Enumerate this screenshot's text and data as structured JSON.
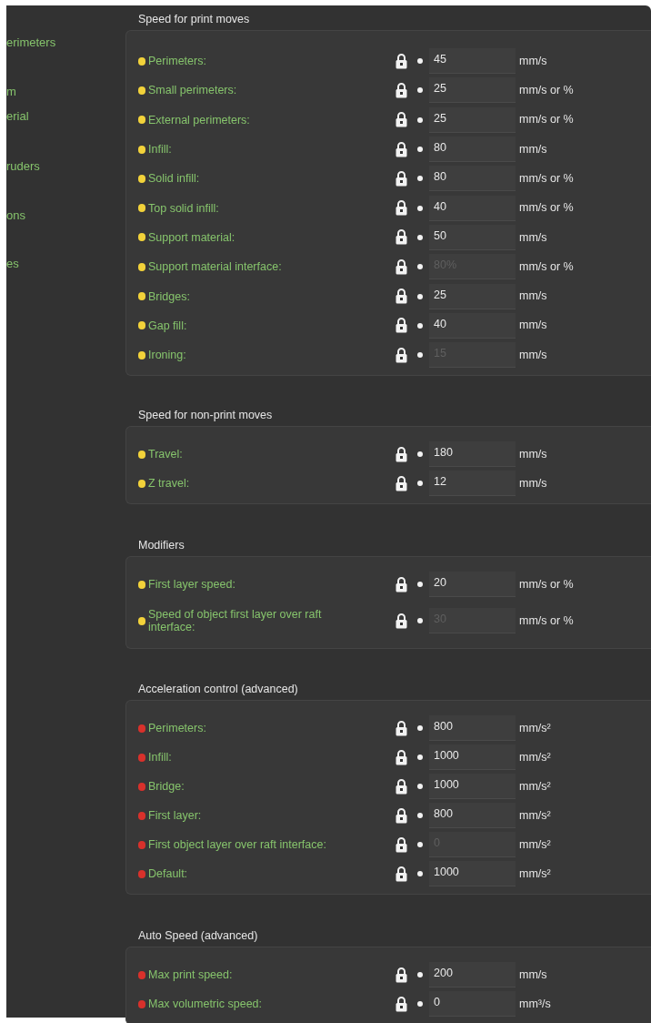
{
  "sidebar": {
    "items": [
      {
        "label": "erimeters"
      },
      {
        "label": "m"
      },
      {
        "label": "erial"
      },
      {
        "label": "ruders"
      },
      {
        "label": "ons"
      },
      {
        "label": "es"
      }
    ]
  },
  "sections": [
    {
      "title": "Speed for print moves",
      "options": [
        {
          "label": "Perimeters:",
          "color": "#f2d23a",
          "value": "45",
          "unit": "mm/s",
          "disabled": false
        },
        {
          "label": "Small perimeters:",
          "color": "#f2d23a",
          "value": "25",
          "unit": "mm/s or %",
          "disabled": false
        },
        {
          "label": "External perimeters:",
          "color": "#f2d23a",
          "value": "25",
          "unit": "mm/s or %",
          "disabled": false
        },
        {
          "label": "Infill:",
          "color": "#f2d23a",
          "value": "80",
          "unit": "mm/s",
          "disabled": false
        },
        {
          "label": "Solid infill:",
          "color": "#f2d23a",
          "value": "80",
          "unit": "mm/s or %",
          "disabled": false
        },
        {
          "label": "Top solid infill:",
          "color": "#f2d23a",
          "value": "40",
          "unit": "mm/s or %",
          "disabled": false
        },
        {
          "label": "Support material:",
          "color": "#f2d23a",
          "value": "50",
          "unit": "mm/s",
          "disabled": false
        },
        {
          "label": "Support material interface:",
          "color": "#f2d23a",
          "value": "80%",
          "unit": "mm/s or %",
          "disabled": true
        },
        {
          "label": "Bridges:",
          "color": "#f2d23a",
          "value": "25",
          "unit": "mm/s",
          "disabled": false
        },
        {
          "label": "Gap fill:",
          "color": "#f2d23a",
          "value": "40",
          "unit": "mm/s",
          "disabled": false
        },
        {
          "label": "Ironing:",
          "color": "#f2d23a",
          "value": "15",
          "unit": "mm/s",
          "disabled": true
        }
      ]
    },
    {
      "title": "Speed for non-print moves",
      "options": [
        {
          "label": "Travel:",
          "color": "#f2d23a",
          "value": "180",
          "unit": "mm/s",
          "disabled": false
        },
        {
          "label": "Z travel:",
          "color": "#f2d23a",
          "value": "12",
          "unit": "mm/s",
          "disabled": false
        }
      ]
    },
    {
      "title": "Modifiers",
      "options": [
        {
          "label": "First layer speed:",
          "color": "#f2d23a",
          "value": "20",
          "unit": "mm/s or %",
          "disabled": false
        },
        {
          "label": "Speed of object first layer over raft interface:",
          "color": "#f2d23a",
          "value": "30",
          "unit": "mm/s or %",
          "disabled": true
        }
      ]
    },
    {
      "title": "Acceleration control (advanced)",
      "options": [
        {
          "label": "Perimeters:",
          "color": "#d8312b",
          "value": "800",
          "unit": "mm/s²",
          "disabled": false
        },
        {
          "label": "Infill:",
          "color": "#d8312b",
          "value": "1000",
          "unit": "mm/s²",
          "disabled": false
        },
        {
          "label": "Bridge:",
          "color": "#d8312b",
          "value": "1000",
          "unit": "mm/s²",
          "disabled": false
        },
        {
          "label": "First layer:",
          "color": "#d8312b",
          "value": "800",
          "unit": "mm/s²",
          "disabled": false
        },
        {
          "label": "First object layer over raft interface:",
          "color": "#d8312b",
          "value": "0",
          "unit": "mm/s²",
          "disabled": true
        },
        {
          "label": "Default:",
          "color": "#d8312b",
          "value": "1000",
          "unit": "mm/s²",
          "disabled": false
        }
      ]
    },
    {
      "title": "Auto Speed (advanced)",
      "options": [
        {
          "label": "Max print speed:",
          "color": "#d8312b",
          "value": "200",
          "unit": "mm/s",
          "disabled": false
        },
        {
          "label": "Max volumetric speed:",
          "color": "#d8312b",
          "value": "0",
          "unit": "mm³/s",
          "disabled": false
        }
      ]
    }
  ]
}
